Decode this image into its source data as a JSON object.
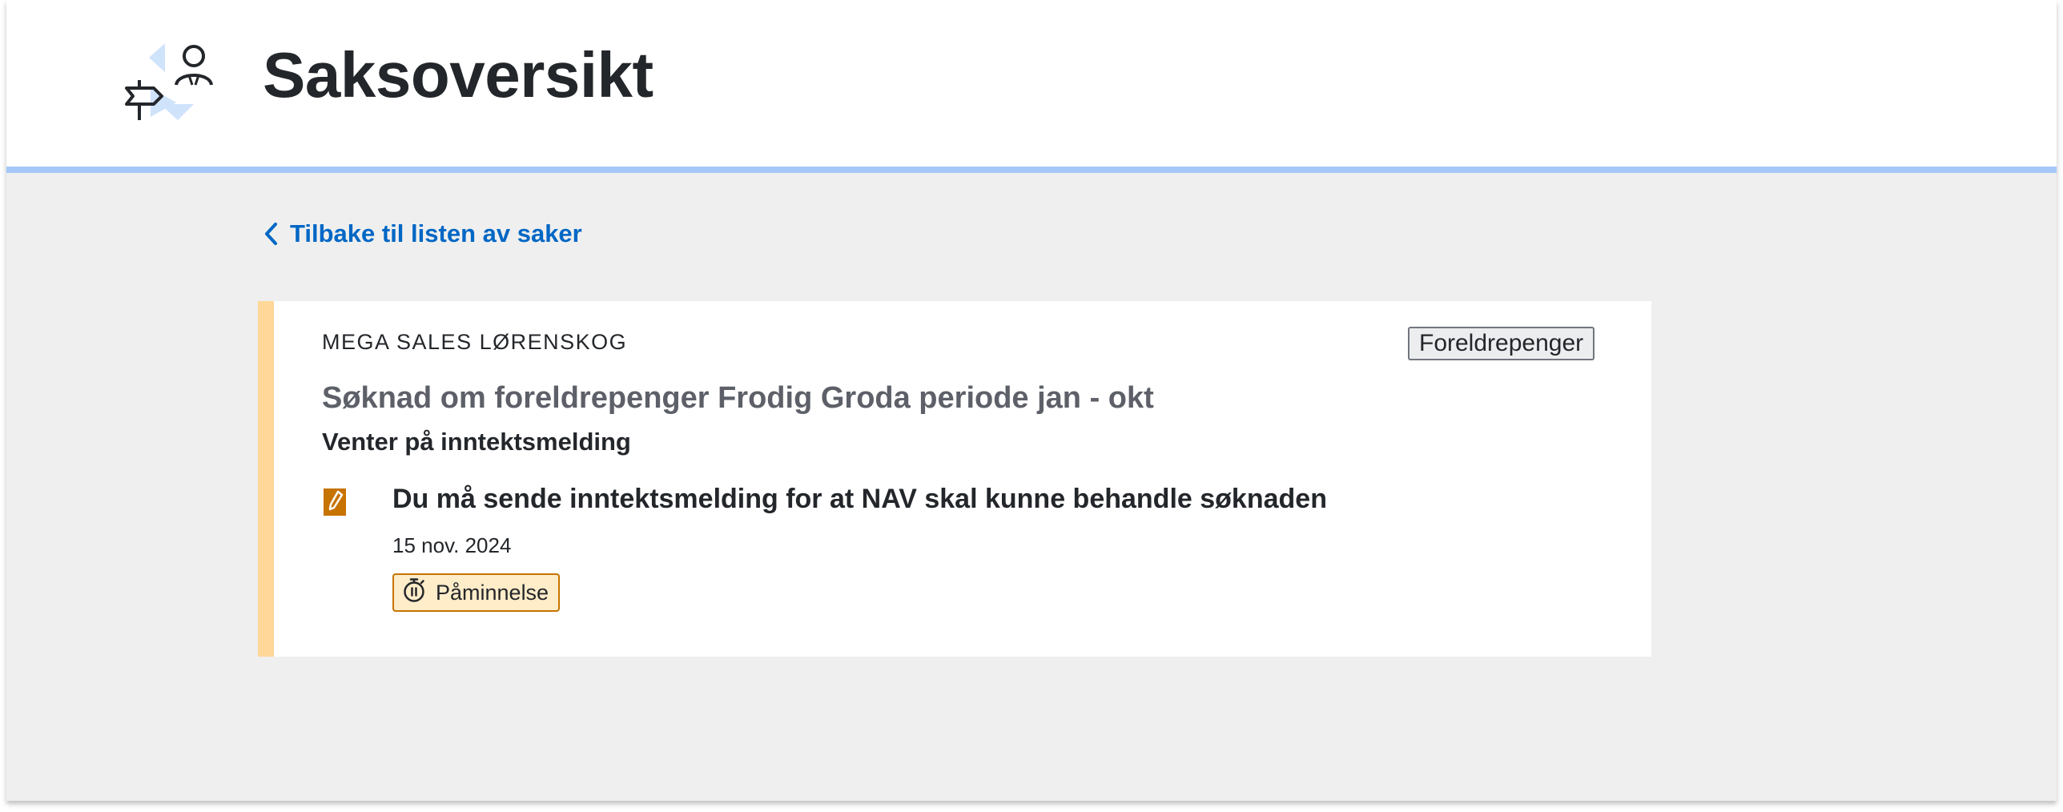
{
  "header": {
    "title": "Saksoversikt",
    "illustration_icon": "signpost-person-illustration"
  },
  "navigation": {
    "back_label": "Tilbake til listen av saker",
    "back_icon": "chevron-left-icon"
  },
  "case": {
    "organization": "MEGA SALES LØRENSKOG",
    "tag": "Foreldrepenger",
    "title": "Søknad om foreldrepenger Frodig Groda periode jan - okt",
    "status": "Venter på inntektsmelding",
    "task": {
      "icon": "task-document-pencil-icon",
      "text": "Du må sende inntektsmelding for at NAV skal kunne behandle søknaden",
      "date": "15 nov. 2024",
      "badge_label": "Påminnelse",
      "badge_icon": "stopwatch-icon"
    }
  },
  "colors": {
    "header_border": "#a5c8f8",
    "card_accent": "#ffd799",
    "link": "#0067c5",
    "task_icon": "#c77300",
    "badge_bg": "#ffecc9",
    "badge_border": "#c77300",
    "page_bg": "#efefef"
  }
}
